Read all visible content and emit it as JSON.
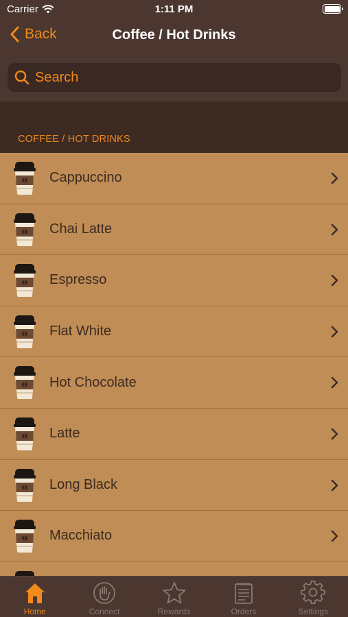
{
  "status_bar": {
    "carrier": "Carrier",
    "time": "1:11 PM"
  },
  "nav": {
    "back_label": "Back",
    "title": "Coffee / Hot Drinks"
  },
  "search": {
    "placeholder": "Search"
  },
  "section": {
    "header": "COFFEE / HOT DRINKS"
  },
  "items": [
    {
      "label": "Cappuccino"
    },
    {
      "label": "Chai Latte"
    },
    {
      "label": "Espresso"
    },
    {
      "label": "Flat White"
    },
    {
      "label": "Hot Chocolate"
    },
    {
      "label": "Latte"
    },
    {
      "label": "Long Black"
    },
    {
      "label": "Macchiato"
    },
    {
      "label": ""
    }
  ],
  "tabs": [
    {
      "label": "Home",
      "icon": "home-icon",
      "active": true
    },
    {
      "label": "Connect",
      "icon": "hand-icon",
      "active": false
    },
    {
      "label": "Rewards",
      "icon": "star-icon",
      "active": false
    },
    {
      "label": "Orders",
      "icon": "notepad-icon",
      "active": false
    },
    {
      "label": "Settings",
      "icon": "gear-icon",
      "active": false
    }
  ],
  "colors": {
    "accent": "#f08a1c",
    "nav_bg": "#4b3730",
    "list_bg": "#bf8d55",
    "text_dark": "#3d2a22"
  }
}
